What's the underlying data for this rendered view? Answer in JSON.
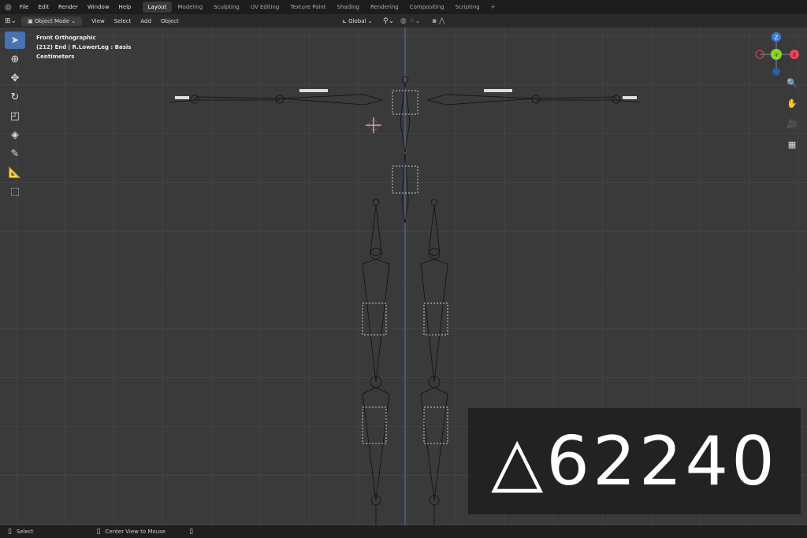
{
  "menu": [
    "File",
    "Edit",
    "Render",
    "Window",
    "Help"
  ],
  "workspaces": [
    "Layout",
    "Modeling",
    "Sculpting",
    "UV Editing",
    "Texture Paint",
    "Shading",
    "Rendering",
    "Compositing",
    "Scripting",
    "+"
  ],
  "header": {
    "mode": "Object Mode",
    "menus": [
      "View",
      "Select",
      "Add",
      "Object"
    ],
    "orientation": "Global"
  },
  "viewport_info": {
    "view": "Front Orthographic",
    "object": "(212) End | R.LowerLeg : Basis",
    "units": "Centimeters"
  },
  "gizmo": {
    "z": "Z",
    "y": "-Y",
    "x": "X"
  },
  "status": {
    "left": "Select",
    "middle": "Center View to Mouse"
  },
  "overlay": {
    "text": "△62240"
  },
  "colors": {
    "accent": "#4772b3",
    "x_axis": "#e8475a",
    "y_axis": "#8cd41f",
    "z_axis": "#3a7ad9"
  }
}
